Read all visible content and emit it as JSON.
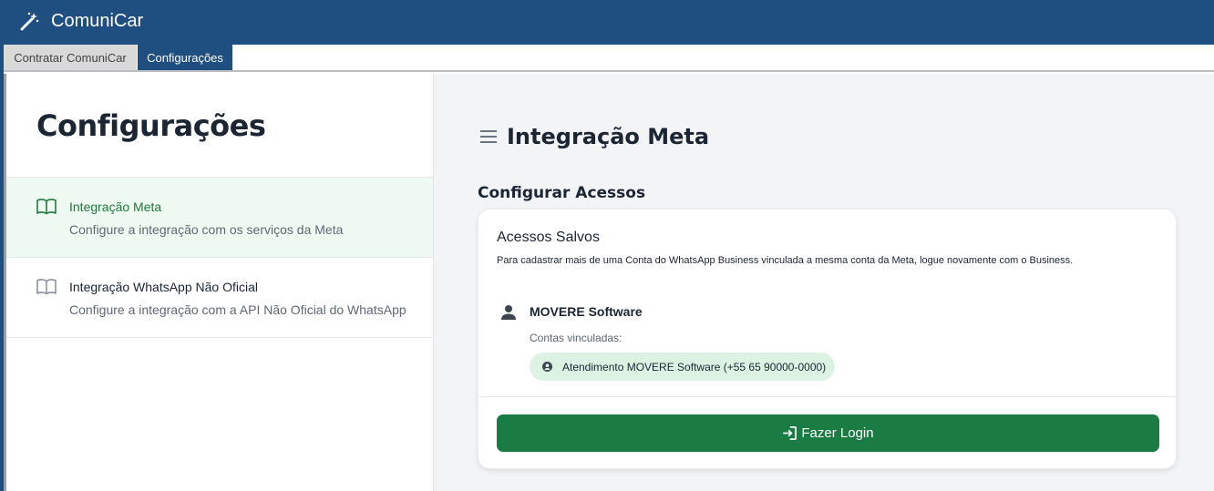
{
  "app": {
    "title": "ComuniCar",
    "icon": "magic-wand-icon"
  },
  "tabs": [
    {
      "label": "Contratar ComuniCar",
      "active": false
    },
    {
      "label": "Configurações",
      "active": true
    }
  ],
  "sidebar": {
    "title": "Configurações",
    "items": [
      {
        "title": "Integração Meta",
        "description": "Configure a integração com os serviços da Meta",
        "icon": "book-open-icon",
        "active": true
      },
      {
        "title": "Integração WhatsApp Não Oficial",
        "description": "Configure a integração com a API Não Oficial do WhatsApp",
        "icon": "book-open-icon",
        "active": false
      }
    ]
  },
  "main": {
    "title": "Integração Meta",
    "section_title": "Configurar Acessos",
    "card": {
      "title": "Acessos Salvos",
      "description": "Para cadastrar mais de uma Conta do WhatsApp Business vinculada a mesma conta da Meta, logue novamente com o Business.",
      "account": {
        "name": "MOVERE Software",
        "linked_label": "Contas vinculadas:",
        "linked_accounts": [
          "Atendimento MOVERE Software (+55 65 90000-0000)"
        ]
      },
      "login_button": "Fazer Login"
    }
  },
  "colors": {
    "header_bg": "#1f4e80",
    "active_green": "#1e7a3c",
    "button_green": "#1a7c43",
    "chip_bg": "#dcf2e2"
  }
}
